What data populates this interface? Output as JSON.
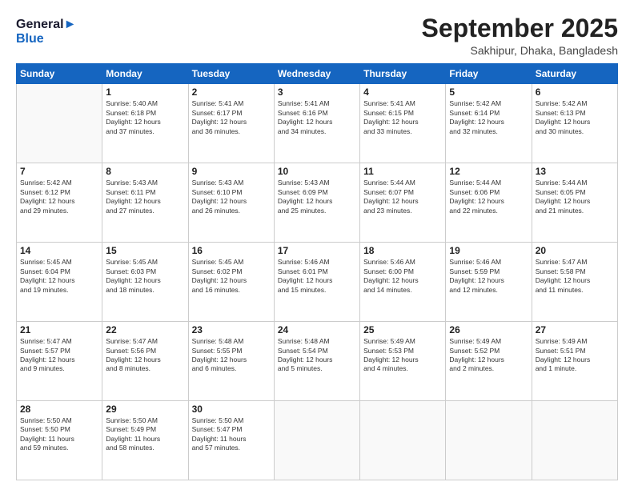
{
  "header": {
    "logo_line1": "General",
    "logo_line2": "Blue",
    "month": "September 2025",
    "location": "Sakhipur, Dhaka, Bangladesh"
  },
  "weekdays": [
    "Sunday",
    "Monday",
    "Tuesday",
    "Wednesday",
    "Thursday",
    "Friday",
    "Saturday"
  ],
  "weeks": [
    [
      {
        "day": "",
        "info": ""
      },
      {
        "day": "1",
        "info": "Sunrise: 5:40 AM\nSunset: 6:18 PM\nDaylight: 12 hours\nand 37 minutes."
      },
      {
        "day": "2",
        "info": "Sunrise: 5:41 AM\nSunset: 6:17 PM\nDaylight: 12 hours\nand 36 minutes."
      },
      {
        "day": "3",
        "info": "Sunrise: 5:41 AM\nSunset: 6:16 PM\nDaylight: 12 hours\nand 34 minutes."
      },
      {
        "day": "4",
        "info": "Sunrise: 5:41 AM\nSunset: 6:15 PM\nDaylight: 12 hours\nand 33 minutes."
      },
      {
        "day": "5",
        "info": "Sunrise: 5:42 AM\nSunset: 6:14 PM\nDaylight: 12 hours\nand 32 minutes."
      },
      {
        "day": "6",
        "info": "Sunrise: 5:42 AM\nSunset: 6:13 PM\nDaylight: 12 hours\nand 30 minutes."
      }
    ],
    [
      {
        "day": "7",
        "info": "Sunrise: 5:42 AM\nSunset: 6:12 PM\nDaylight: 12 hours\nand 29 minutes."
      },
      {
        "day": "8",
        "info": "Sunrise: 5:43 AM\nSunset: 6:11 PM\nDaylight: 12 hours\nand 27 minutes."
      },
      {
        "day": "9",
        "info": "Sunrise: 5:43 AM\nSunset: 6:10 PM\nDaylight: 12 hours\nand 26 minutes."
      },
      {
        "day": "10",
        "info": "Sunrise: 5:43 AM\nSunset: 6:09 PM\nDaylight: 12 hours\nand 25 minutes."
      },
      {
        "day": "11",
        "info": "Sunrise: 5:44 AM\nSunset: 6:07 PM\nDaylight: 12 hours\nand 23 minutes."
      },
      {
        "day": "12",
        "info": "Sunrise: 5:44 AM\nSunset: 6:06 PM\nDaylight: 12 hours\nand 22 minutes."
      },
      {
        "day": "13",
        "info": "Sunrise: 5:44 AM\nSunset: 6:05 PM\nDaylight: 12 hours\nand 21 minutes."
      }
    ],
    [
      {
        "day": "14",
        "info": "Sunrise: 5:45 AM\nSunset: 6:04 PM\nDaylight: 12 hours\nand 19 minutes."
      },
      {
        "day": "15",
        "info": "Sunrise: 5:45 AM\nSunset: 6:03 PM\nDaylight: 12 hours\nand 18 minutes."
      },
      {
        "day": "16",
        "info": "Sunrise: 5:45 AM\nSunset: 6:02 PM\nDaylight: 12 hours\nand 16 minutes."
      },
      {
        "day": "17",
        "info": "Sunrise: 5:46 AM\nSunset: 6:01 PM\nDaylight: 12 hours\nand 15 minutes."
      },
      {
        "day": "18",
        "info": "Sunrise: 5:46 AM\nSunset: 6:00 PM\nDaylight: 12 hours\nand 14 minutes."
      },
      {
        "day": "19",
        "info": "Sunrise: 5:46 AM\nSunset: 5:59 PM\nDaylight: 12 hours\nand 12 minutes."
      },
      {
        "day": "20",
        "info": "Sunrise: 5:47 AM\nSunset: 5:58 PM\nDaylight: 12 hours\nand 11 minutes."
      }
    ],
    [
      {
        "day": "21",
        "info": "Sunrise: 5:47 AM\nSunset: 5:57 PM\nDaylight: 12 hours\nand 9 minutes."
      },
      {
        "day": "22",
        "info": "Sunrise: 5:47 AM\nSunset: 5:56 PM\nDaylight: 12 hours\nand 8 minutes."
      },
      {
        "day": "23",
        "info": "Sunrise: 5:48 AM\nSunset: 5:55 PM\nDaylight: 12 hours\nand 6 minutes."
      },
      {
        "day": "24",
        "info": "Sunrise: 5:48 AM\nSunset: 5:54 PM\nDaylight: 12 hours\nand 5 minutes."
      },
      {
        "day": "25",
        "info": "Sunrise: 5:49 AM\nSunset: 5:53 PM\nDaylight: 12 hours\nand 4 minutes."
      },
      {
        "day": "26",
        "info": "Sunrise: 5:49 AM\nSunset: 5:52 PM\nDaylight: 12 hours\nand 2 minutes."
      },
      {
        "day": "27",
        "info": "Sunrise: 5:49 AM\nSunset: 5:51 PM\nDaylight: 12 hours\nand 1 minute."
      }
    ],
    [
      {
        "day": "28",
        "info": "Sunrise: 5:50 AM\nSunset: 5:50 PM\nDaylight: 11 hours\nand 59 minutes."
      },
      {
        "day": "29",
        "info": "Sunrise: 5:50 AM\nSunset: 5:49 PM\nDaylight: 11 hours\nand 58 minutes."
      },
      {
        "day": "30",
        "info": "Sunrise: 5:50 AM\nSunset: 5:47 PM\nDaylight: 11 hours\nand 57 minutes."
      },
      {
        "day": "",
        "info": ""
      },
      {
        "day": "",
        "info": ""
      },
      {
        "day": "",
        "info": ""
      },
      {
        "day": "",
        "info": ""
      }
    ]
  ]
}
